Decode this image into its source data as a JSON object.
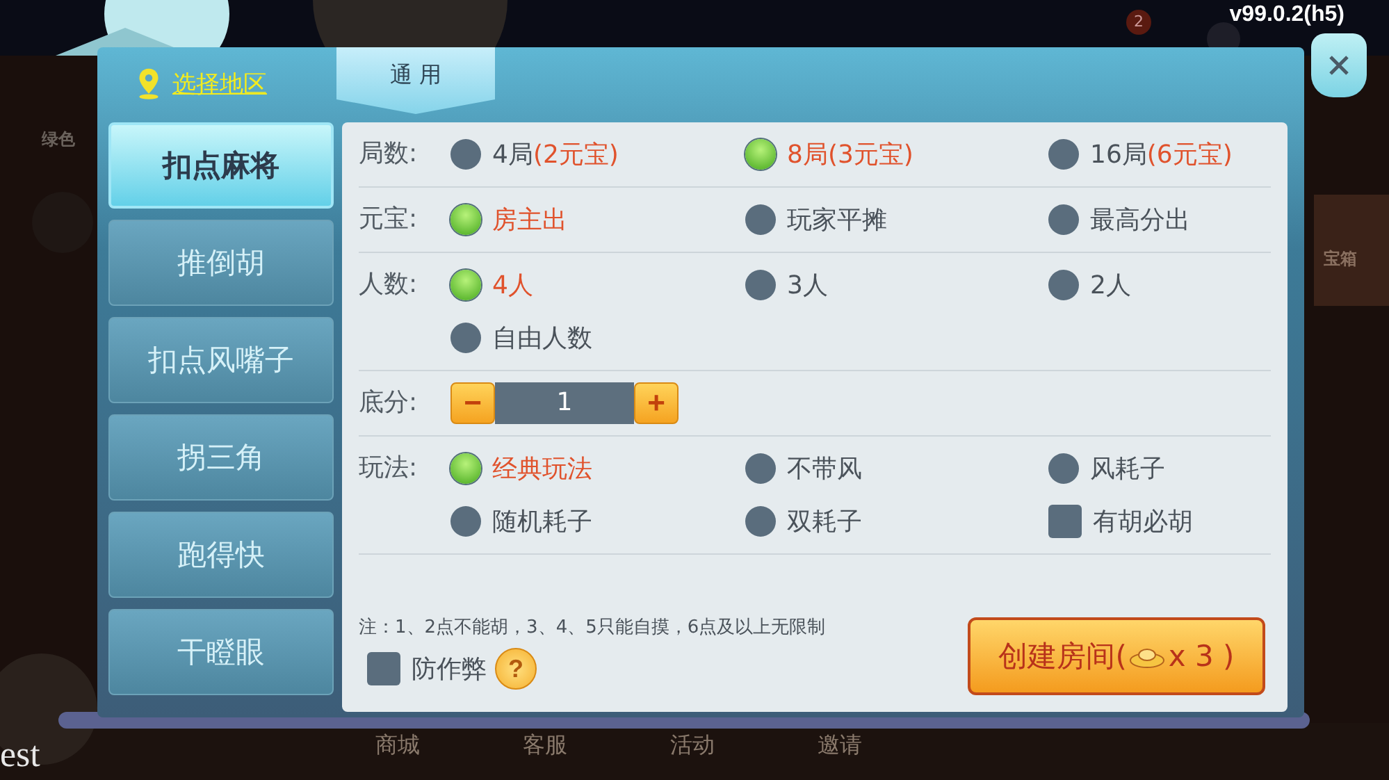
{
  "background": {
    "version": "v99.0.2(h5)",
    "mail_badge": "2",
    "side_label_left": "绿色",
    "side_label_right": "宝箱",
    "corner_text": "est",
    "bottom_nav": [
      "商城",
      "客服",
      "活动",
      "邀请"
    ]
  },
  "dialog": {
    "region_link": "选择地区",
    "tab": "通 用",
    "games": [
      {
        "label": "扣点麻将",
        "selected": true
      },
      {
        "label": "推倒胡",
        "selected": false
      },
      {
        "label": "扣点风嘴子",
        "selected": false
      },
      {
        "label": "拐三角",
        "selected": false
      },
      {
        "label": "跑得快",
        "selected": false
      },
      {
        "label": "干瞪眼",
        "selected": false
      }
    ],
    "rows": [
      {
        "kind": "options",
        "label": "局数:",
        "options": [
          {
            "kind": "radio",
            "text": "4局",
            "note": "(2元宝)",
            "selected": false
          },
          {
            "kind": "radio",
            "text": "8局",
            "note": "(3元宝)",
            "selected": true
          },
          {
            "kind": "radio",
            "text": "16局",
            "note": "(6元宝)",
            "selected": false
          }
        ]
      },
      {
        "kind": "options",
        "label": "元宝:",
        "options": [
          {
            "kind": "radio",
            "text": "房主出",
            "selected": true
          },
          {
            "kind": "radio",
            "text": "玩家平摊",
            "selected": false
          },
          {
            "kind": "radio",
            "text": "最高分出",
            "selected": false
          }
        ]
      },
      {
        "kind": "options",
        "label": "人数:",
        "options": [
          {
            "kind": "radio",
            "text": "4人",
            "selected": true
          },
          {
            "kind": "radio",
            "text": "3人",
            "selected": false
          },
          {
            "kind": "radio",
            "text": "2人",
            "selected": false
          },
          {
            "kind": "radio",
            "text": "自由人数",
            "selected": false
          }
        ]
      },
      {
        "kind": "stepper",
        "label": "底分:",
        "minus": "−",
        "value": "1",
        "plus": "+"
      },
      {
        "kind": "options",
        "label": "玩法:",
        "options": [
          {
            "kind": "radio",
            "text": "经典玩法",
            "selected": true
          },
          {
            "kind": "radio",
            "text": "不带风",
            "selected": false
          },
          {
            "kind": "radio",
            "text": "风耗子",
            "selected": false
          },
          {
            "kind": "radio",
            "text": "随机耗子",
            "selected": false
          },
          {
            "kind": "radio",
            "text": "双耗子",
            "selected": false
          },
          {
            "kind": "checkbox",
            "text": "有胡必胡",
            "checked": false
          }
        ]
      }
    ],
    "note": "注：1、2点不能胡，3、4、5只能自摸，6点及以上无限制",
    "anticheat": {
      "text": "防作弊",
      "checked": false,
      "help": "?"
    },
    "create_button": {
      "text": "创建房间(",
      "cost": "x 3 )"
    }
  }
}
